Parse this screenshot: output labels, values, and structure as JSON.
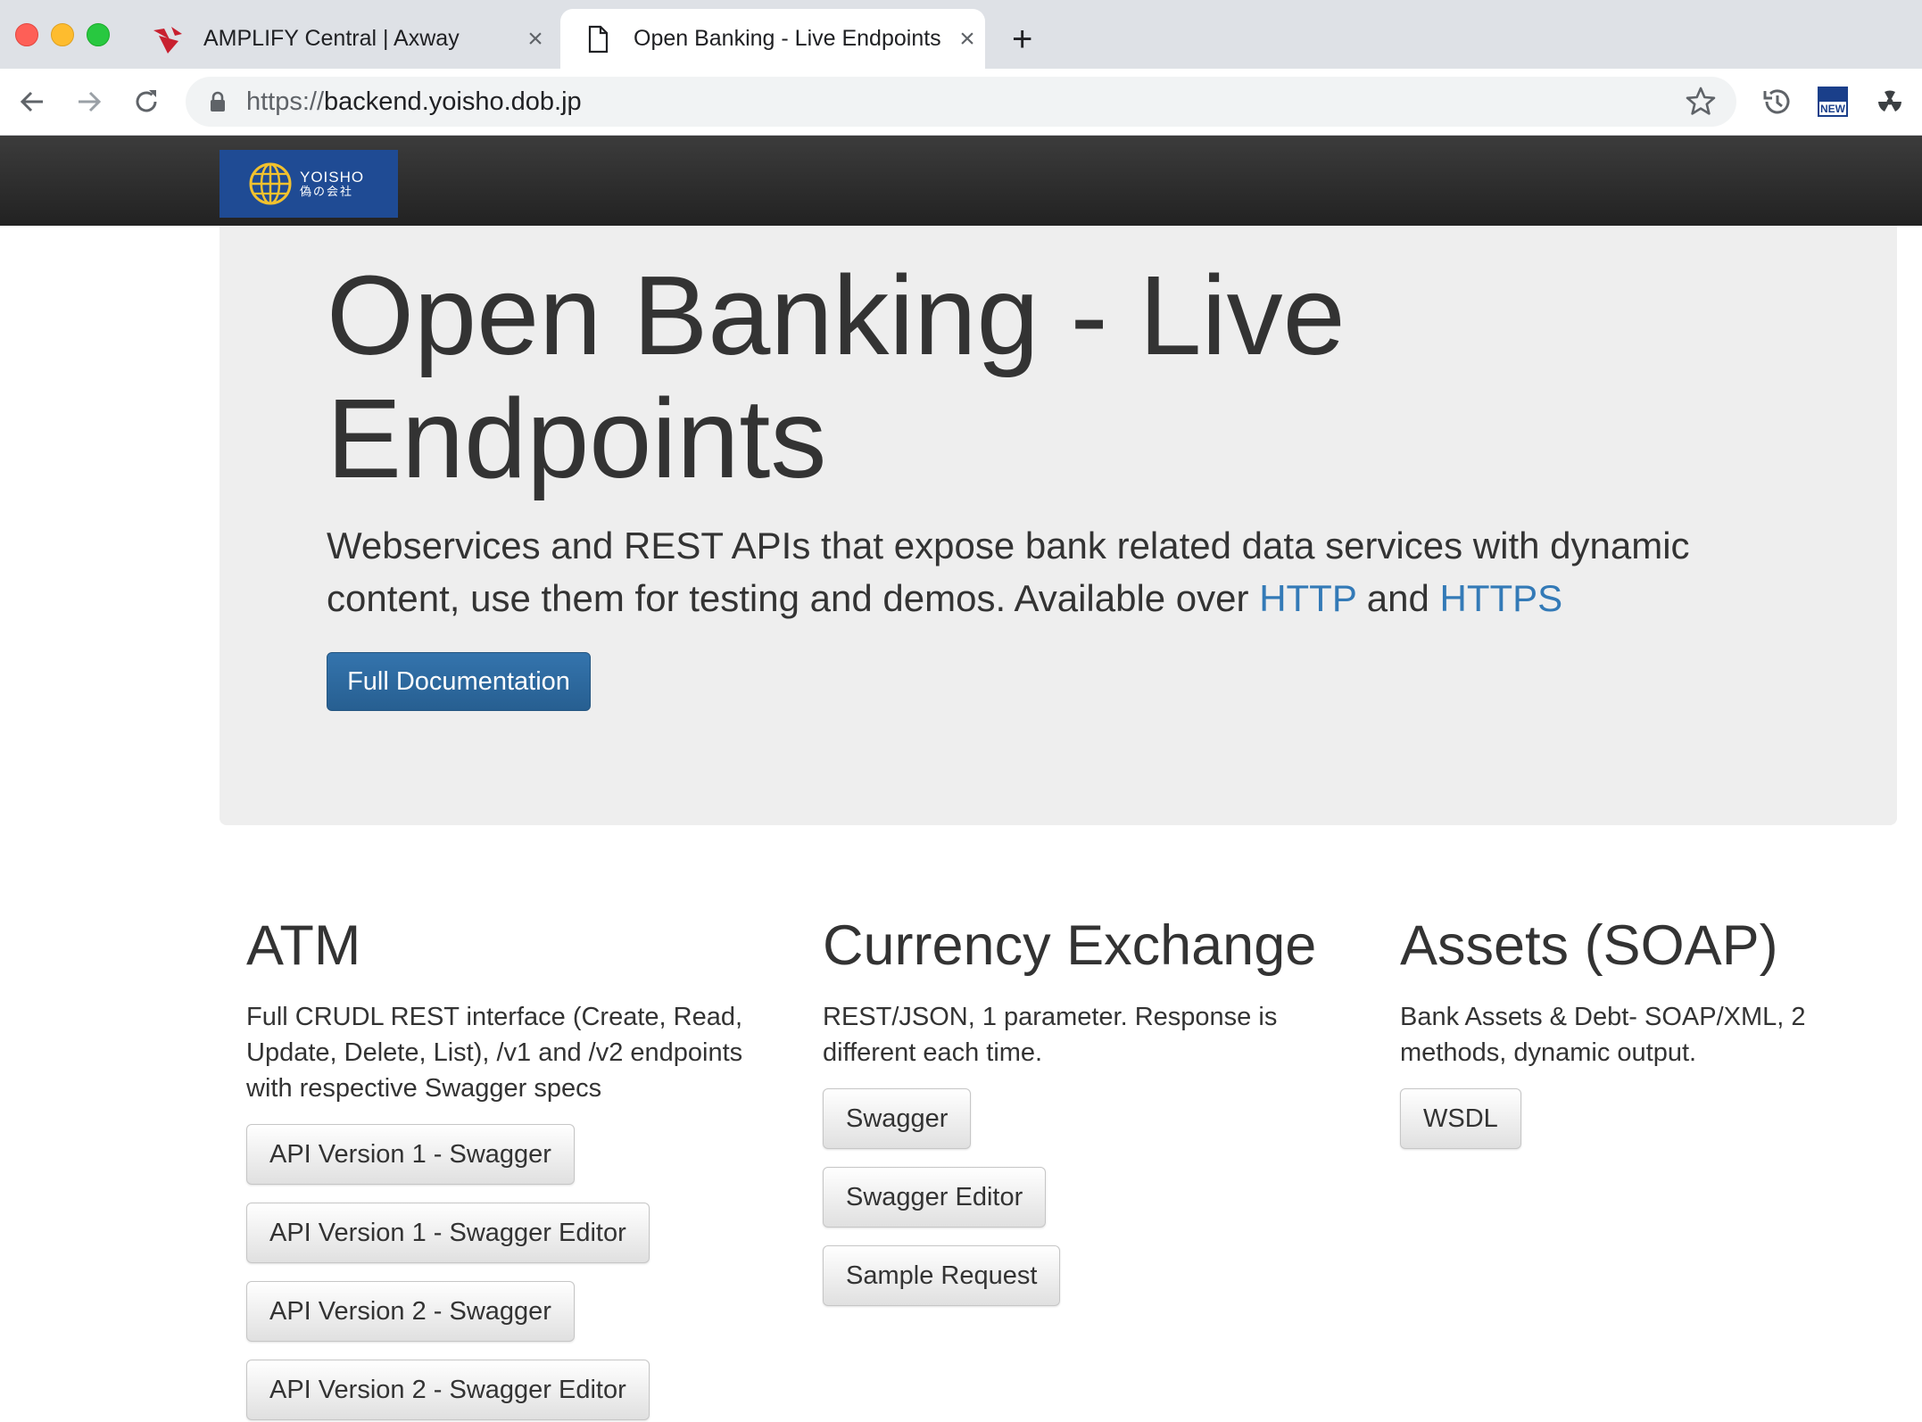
{
  "browser": {
    "tabs": [
      {
        "label": "AMPLIFY Central | Axway",
        "active": false
      },
      {
        "label": "Open Banking - Live Endpoints",
        "active": true
      }
    ],
    "url_scheme": "https://",
    "url_host": "backend.yoisho.dob.jp"
  },
  "navbar": {
    "brand_name": "YOISHO",
    "brand_sub": "偽の会社"
  },
  "hero": {
    "title": "Open Banking - Live Endpoints",
    "lead_text": "Webservices and REST APIs that expose bank related data services with dynamic content, use them for testing and demos. Available over ",
    "link_http": "HTTP",
    "lead_and": " and ",
    "link_https": "HTTPS",
    "button": "Full Documentation"
  },
  "sections": {
    "atm": {
      "title": "ATM",
      "description": "Full CRUDL REST interface (Create, Read, Update, Delete, List), /v1 and /v2 endpoints with respective Swagger specs",
      "buttons": [
        "API Version 1 - Swagger",
        "API Version 1 - Swagger Editor",
        "API Version 2 - Swagger",
        "API Version 2 - Swagger Editor"
      ]
    },
    "fx": {
      "title": "Currency Exchange",
      "description": "REST/JSON, 1 parameter. Response is different each time.",
      "buttons": [
        "Swagger",
        "Swagger Editor",
        "Sample Request"
      ]
    },
    "assets": {
      "title": "Assets (SOAP)",
      "description": "Bank Assets & Debt- SOAP/XML, 2 methods, dynamic output.",
      "buttons": [
        "WSDL"
      ]
    }
  },
  "colors": {
    "navbar": "#222222",
    "brand_bg": "#1f4b94",
    "jumbotron": "#eeeeee",
    "primary": "#337ab7",
    "link": "#337ab7"
  }
}
